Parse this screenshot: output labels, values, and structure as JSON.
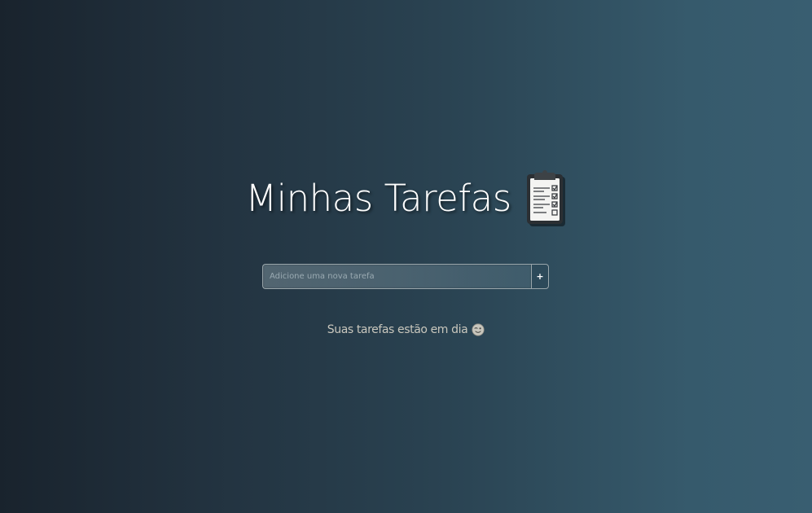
{
  "header": {
    "title": "Minhas Tarefas",
    "icon": "clipboard-icon"
  },
  "form": {
    "input_placeholder": "Adicione uma nova tarefa",
    "input_value": "",
    "add_button_label": "+"
  },
  "status": {
    "message": "Suas tarefas estão em dia",
    "icon": "winking-face-icon"
  },
  "colors": {
    "background_left": "#19232d",
    "background_right": "#395e71",
    "title_text": "#ffffff",
    "status_text": "#c9c7bd"
  }
}
